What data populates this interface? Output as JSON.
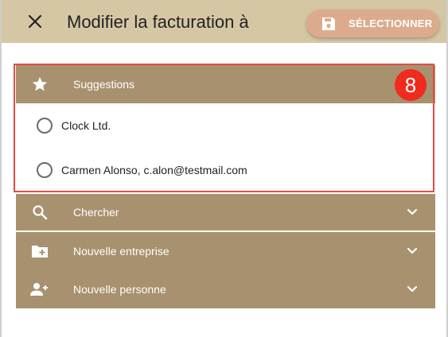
{
  "header": {
    "close_icon": "close-icon",
    "title": "Modifier la facturation à",
    "select_button": {
      "icon": "save-icon",
      "label": "SÉLECTIONNER"
    }
  },
  "suggestions": {
    "icon": "star-icon",
    "label": "Suggestions",
    "options": [
      {
        "label": "Clock Ltd.",
        "selected": false
      },
      {
        "label": "Carmen Alonso, c.alon@testmail.com",
        "selected": false
      }
    ]
  },
  "panels": {
    "search": {
      "icon": "search-icon",
      "label": "Chercher"
    },
    "new_company": {
      "icon": "add-folder-icon",
      "label": "Nouvelle entreprise"
    },
    "new_person": {
      "icon": "add-person-icon",
      "label": "Nouvelle personne"
    }
  },
  "annotation": {
    "badge": "8",
    "color": "#f12a1e",
    "outline_color": "#e84a4a"
  },
  "colors": {
    "header_bg": "#d6c7a4",
    "panel_bg": "#a8916f",
    "button_bg": "#dcab8e"
  }
}
